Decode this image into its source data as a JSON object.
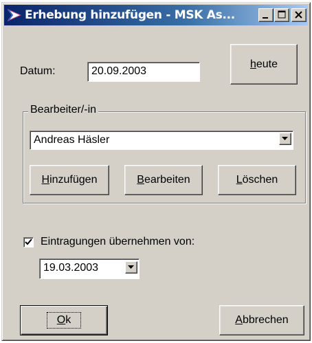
{
  "window": {
    "title": "Erhebung hinzufügen - MSK As...",
    "controls": [
      "minimize-icon",
      "maximize-icon",
      "close-icon"
    ]
  },
  "date": {
    "label": "Datum:",
    "value": "20.09.2003"
  },
  "today_button": {
    "hotkey": "h",
    "rest": "eute"
  },
  "editor_group": {
    "legend": "Bearbeiter/-in",
    "selected": "Andreas Häsler",
    "add": {
      "hotkey": "H",
      "rest": "inzufügen"
    },
    "edit": {
      "hotkey": "B",
      "rest": "earbeiten"
    },
    "delete": {
      "hotkey": "L",
      "rest": "öschen"
    }
  },
  "copy_entries": {
    "checked": true,
    "label": "Eintragungen übernehmen von:",
    "selected": "19.03.2003"
  },
  "ok_button": {
    "hotkey": "O",
    "rest": "k"
  },
  "cancel_button": {
    "hotkey": "A",
    "rest": "bbrechen"
  }
}
